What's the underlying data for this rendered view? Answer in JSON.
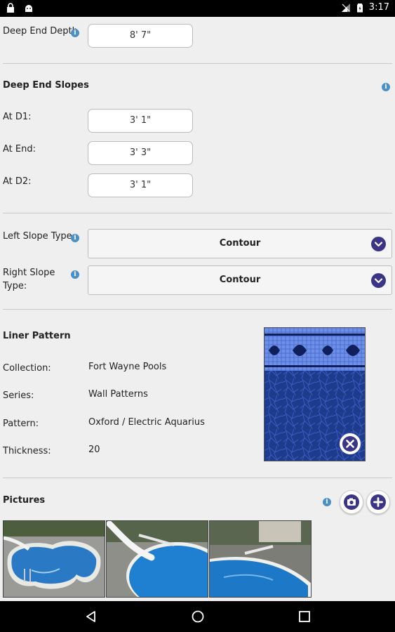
{
  "status_bar": {
    "time": "3:17",
    "left_icons": [
      "lock-icon",
      "android-icon"
    ],
    "right_icons": [
      "no-signal-icon",
      "battery-icon"
    ]
  },
  "deep_end_depth": {
    "label": "Deep End Depth",
    "value": "8' 7\""
  },
  "deep_end_slopes": {
    "title": "Deep End Slopes",
    "at_d1_label": "At D1:",
    "at_d1_value": "3' 1\"",
    "at_end_label": "At End:",
    "at_end_value": "3' 3\"",
    "at_d2_label": "At D2:",
    "at_d2_value": "3' 1\""
  },
  "slope_types": {
    "left_label": "Left Slope Type",
    "left_value": "Contour",
    "right_label_line1": "Right Slope",
    "right_label_line2": "Type:",
    "right_value": "Contour"
  },
  "liner_pattern": {
    "title": "Liner Pattern",
    "collection_label": "Collection:",
    "collection_value": "Fort Wayne Pools",
    "series_label": "Series:",
    "series_value": "Wall Patterns",
    "pattern_label": "Pattern:",
    "pattern_value": "Oxford / Electric Aquarius",
    "thickness_label": "Thickness:",
    "thickness_value": "20"
  },
  "pictures": {
    "title": "Pictures"
  },
  "info_glyph": "i",
  "colors": {
    "accent": "#3b3587",
    "info": "#4a90c8",
    "background": "#efefef"
  }
}
